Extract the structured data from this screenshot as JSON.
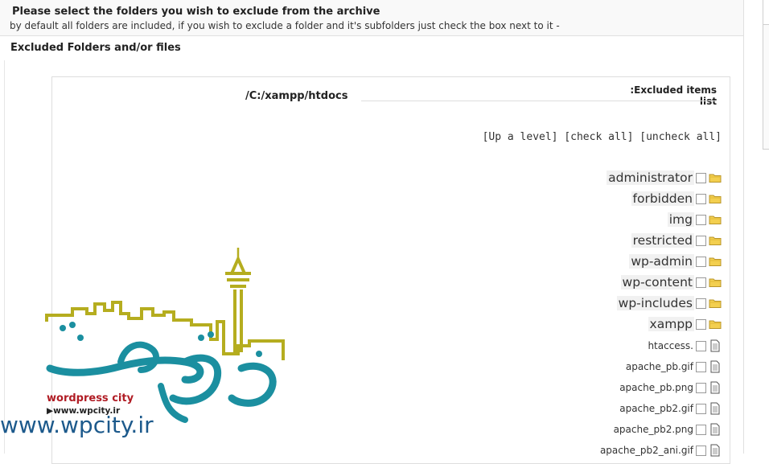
{
  "header": {
    "title": "Please select the folders you wish to exclude from the archive",
    "description": "by default all folders are included, if you wish to exclude a folder and it's subfolders just check the box next to it -"
  },
  "section": {
    "title": "Excluded Folders and/or files"
  },
  "browser": {
    "excluded_list_label": ":Excluded items list",
    "current_path": "/C:/xampp/htdocs",
    "up_level": "[Up a level]",
    "check_all": "[check all]",
    "uncheck_all": "[uncheck all]",
    "folders": [
      {
        "name": "administrator",
        "icon": "folder-icon"
      },
      {
        "name": "forbidden",
        "icon": "folder-icon"
      },
      {
        "name": "img",
        "icon": "folder-icon"
      },
      {
        "name": "restricted",
        "icon": "folder-icon"
      },
      {
        "name": "wp-admin",
        "icon": "folder-icon"
      },
      {
        "name": "wp-content",
        "icon": "folder-icon"
      },
      {
        "name": "wp-includes",
        "icon": "folder-icon"
      },
      {
        "name": "xampp",
        "icon": "folder-icon"
      }
    ],
    "files": [
      {
        "name": "htaccess.",
        "icon": "file-icon"
      },
      {
        "name": "apache_pb.gif",
        "icon": "file-icon"
      },
      {
        "name": "apache_pb.png",
        "icon": "file-icon"
      },
      {
        "name": "apache_pb2.gif",
        "icon": "file-icon"
      },
      {
        "name": "apache_pb2.png",
        "icon": "file-icon"
      },
      {
        "name": "apache_pb2_ani.gif",
        "icon": "file-icon"
      }
    ]
  },
  "watermark": {
    "brand": "wordpress city",
    "small_url": "▶www.wpcity.ir",
    "url": "www.wpcity.ir"
  },
  "colors": {
    "folder_yellow": "#f3cf4f",
    "logo_teal": "#1b8fa0",
    "logo_olive": "#b5ad1f",
    "brand_red": "#b01c24"
  }
}
